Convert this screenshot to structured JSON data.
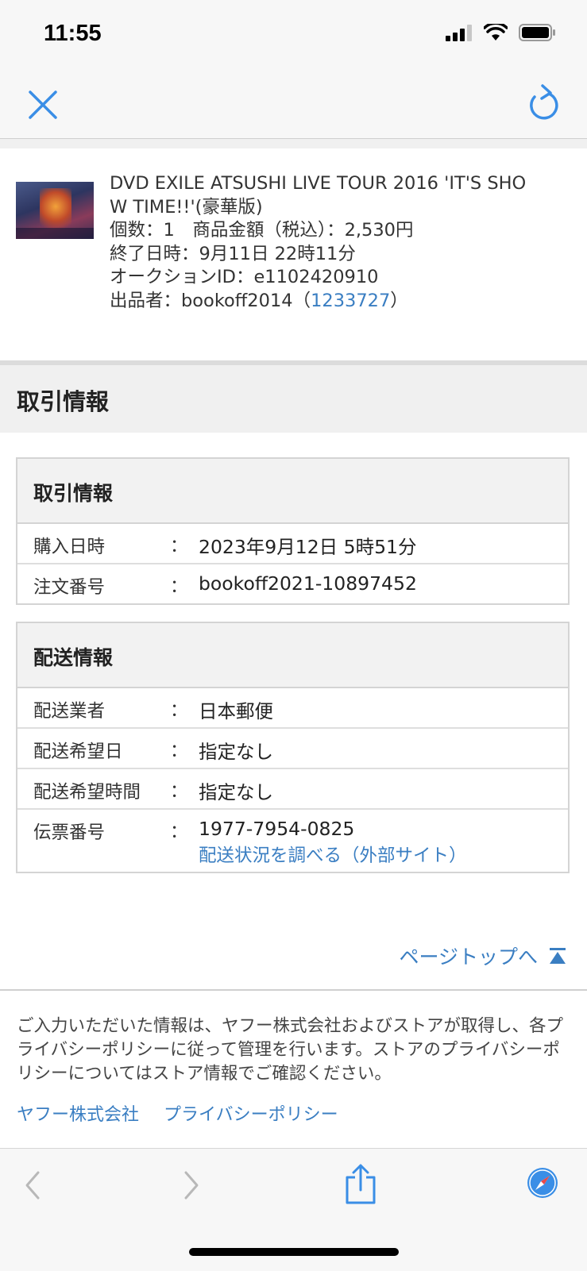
{
  "status_bar": {
    "time": "11:55"
  },
  "item": {
    "title_line1": "DVD EXILE ATSUSHI LIVE TOUR 2016 'IT'S SHO",
    "title_line2": "W TIME!!'(豪華版)",
    "quantity_price": "個数：1　商品金額（税込）：2,530円",
    "end_time": "終了日時：9月11日 22時11分",
    "auction_id": "オークションID：e1102420910",
    "seller_prefix": "出品者：bookoff2014（",
    "seller_rating": "1233727",
    "seller_suffix": "）"
  },
  "section_title": "取引情報",
  "transaction": {
    "heading": "取引情報",
    "rows": [
      {
        "label": "購入日時",
        "colon": "：",
        "value": "2023年9月12日 5時51分"
      },
      {
        "label": "注文番号",
        "colon": "：",
        "value": "bookoff2021-10897452"
      }
    ]
  },
  "shipping": {
    "heading": "配送情報",
    "rows": [
      {
        "label": "配送業者",
        "colon": "：",
        "value": "日本郵便"
      },
      {
        "label": "配送希望日",
        "colon": "：",
        "value": "指定なし"
      },
      {
        "label": "配送希望時間",
        "colon": "：",
        "value": "指定なし"
      },
      {
        "label": "伝票番号",
        "colon": "：",
        "value": "1977-7954-0825",
        "link": "配送状況を調べる（外部サイト）"
      }
    ]
  },
  "page_top": "ページトップへ",
  "footer": {
    "notice": "ご入力いただいた情報は、ヤフー株式会社およびストアが取得し、各プライバシーポリシーに従って管理を行います。ストアのプライバシーポリシーについてはストア情報でご確認ください。",
    "links": [
      "ヤフー株式会社",
      "プライバシーポリシー"
    ]
  },
  "colors": {
    "link": "#3a7ec2",
    "bar_bg": "#f7f7f7"
  },
  "icons": [
    "close-icon",
    "reload-icon",
    "back-icon",
    "forward-icon",
    "share-icon",
    "compass-icon",
    "page-top-icon"
  ]
}
